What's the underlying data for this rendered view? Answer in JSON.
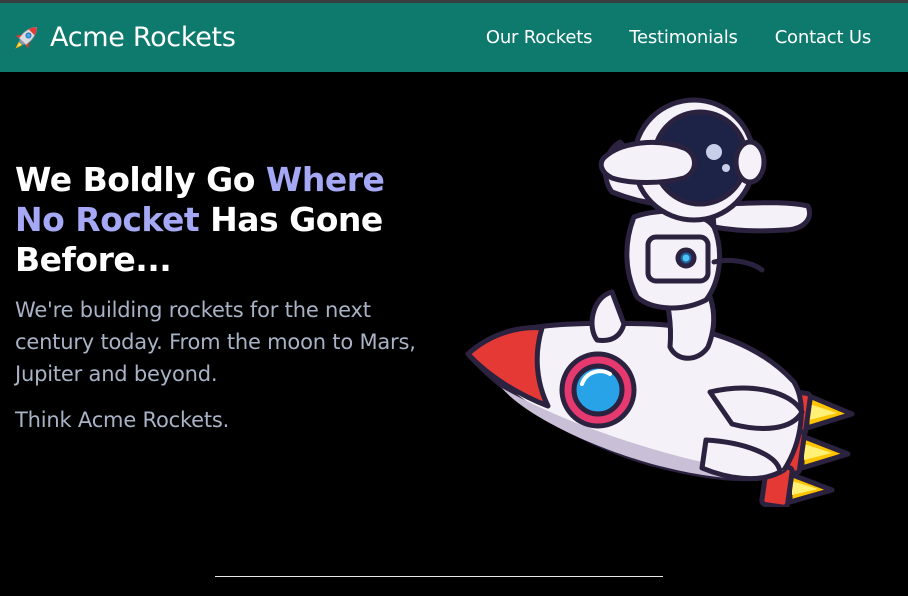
{
  "brand": {
    "name": "Acme Rockets",
    "icon": "rocket-icon"
  },
  "nav": {
    "items": [
      {
        "label": "Our Rockets"
      },
      {
        "label": "Testimonials"
      },
      {
        "label": "Contact Us"
      }
    ]
  },
  "hero": {
    "headline_part1": "We Boldly Go ",
    "headline_highlight": "Where No Rocket",
    "headline_part2": " Has Gone Before...",
    "lead": "We're building rockets for the next century today. From the moon to Mars, Jupiter and beyond.",
    "tagline": "Think Acme Rockets.",
    "illustration": "astronaut-riding-rocket"
  },
  "colors": {
    "nav_background": "#0e7a6e",
    "page_background": "#000000",
    "highlight": "#a5a8f5",
    "body_text": "#a9b3c6"
  }
}
